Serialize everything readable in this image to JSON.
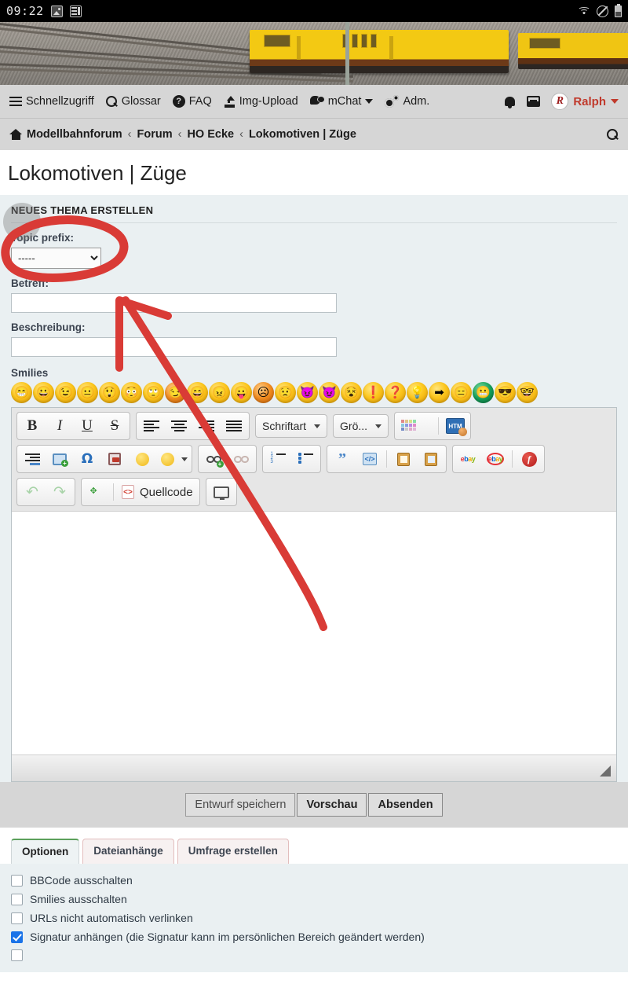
{
  "statusbar": {
    "time": "09:22",
    "left_icons": [
      "photo-icon",
      "news-icon"
    ],
    "right_icons": [
      "wifi-icon",
      "do-not-disturb-icon",
      "battery-icon"
    ]
  },
  "nav": {
    "items": [
      {
        "label": "Schnellzugriff",
        "icon": "hamburger-icon"
      },
      {
        "label": "Glossar",
        "icon": "search-icon"
      },
      {
        "label": "FAQ",
        "icon": "question-circle-icon"
      },
      {
        "label": "Img-Upload",
        "icon": "upload-icon"
      },
      {
        "label": "mChat",
        "icon": "chat-icon",
        "caret": true
      },
      {
        "label": "Adm.",
        "icon": "gears-icon"
      }
    ],
    "notifications_icon": "bell-icon",
    "messages_icon": "inbox-icon",
    "user": {
      "name": "Ralph",
      "avatar_initials": "R",
      "caret": true
    },
    "user_color": "#c0392b"
  },
  "breadcrumb": {
    "home_icon": "home-icon",
    "items": [
      "Modellbahnforum",
      "Forum",
      "HO Ecke",
      "Lokomotiven | Züge"
    ],
    "separator": "‹",
    "search_icon": "search-icon"
  },
  "page": {
    "title": "Lokomotiven | Züge",
    "panel_heading": "NEUES THEMA ERSTELLEN"
  },
  "form": {
    "topic_prefix_label": "Topic prefix:",
    "topic_prefix_value": "-----",
    "topic_prefix_options": [
      "-----"
    ],
    "subject_label": "Betreff:",
    "subject_value": "",
    "subject_placeholder": "",
    "description_label": "Beschreibung:",
    "description_value": "",
    "description_placeholder": "",
    "smilies_label": "Smilies",
    "message_value": ""
  },
  "smilies": [
    {
      "name": "smiley-grin",
      "glyph": "😁",
      "color": "yellow"
    },
    {
      "name": "smiley-smile",
      "glyph": "😀",
      "color": "yellow"
    },
    {
      "name": "smiley-wink",
      "glyph": "😉",
      "color": "yellow"
    },
    {
      "name": "smiley-neutral",
      "glyph": "😐",
      "color": "yellow"
    },
    {
      "name": "smiley-shocked",
      "glyph": "😲",
      "color": "yellow"
    },
    {
      "name": "smiley-eek",
      "glyph": "😳",
      "color": "yellow"
    },
    {
      "name": "smiley-rolleyes",
      "glyph": "🙄",
      "color": "yellow"
    },
    {
      "name": "smiley-cool-wink",
      "glyph": "😏",
      "color": "orange"
    },
    {
      "name": "smiley-laugh",
      "glyph": "😄",
      "color": "yellow"
    },
    {
      "name": "smiley-angry",
      "glyph": "😠",
      "color": "yellow"
    },
    {
      "name": "smiley-tongue",
      "glyph": "😛",
      "color": "yellow"
    },
    {
      "name": "smiley-sad",
      "glyph": "☹",
      "color": "orange"
    },
    {
      "name": "smiley-worried",
      "glyph": "😟",
      "color": "yellow"
    },
    {
      "name": "smiley-devil",
      "glyph": "😈",
      "color": "yellow"
    },
    {
      "name": "smiley-evil-grin",
      "glyph": "😈",
      "color": "yellow"
    },
    {
      "name": "smiley-roll",
      "glyph": "😵",
      "color": "yellow"
    },
    {
      "name": "smiley-exclamation",
      "glyph": "❗",
      "color": "yellow"
    },
    {
      "name": "smiley-question",
      "glyph": "❓",
      "color": "yellow"
    },
    {
      "name": "smiley-idea",
      "glyph": "💡",
      "color": "yellow"
    },
    {
      "name": "smiley-arrow",
      "glyph": "➡",
      "color": "yellow"
    },
    {
      "name": "smiley-indifferent",
      "glyph": "😑",
      "color": "yellow"
    },
    {
      "name": "smiley-green-grin",
      "glyph": "😬",
      "color": "green"
    },
    {
      "name": "smiley-glasses",
      "glyph": "😎",
      "color": "yellow"
    },
    {
      "name": "smiley-nerd",
      "glyph": "🤓",
      "color": "yellow"
    }
  ],
  "toolbar": {
    "row1": {
      "format": [
        {
          "name": "bold-button",
          "label": "B"
        },
        {
          "name": "italic-button",
          "label": "I"
        },
        {
          "name": "underline-button",
          "label": "U"
        },
        {
          "name": "strikethrough-button",
          "label": "S"
        }
      ],
      "align": [
        "align-left-button",
        "align-center-button",
        "align-right-button",
        "align-justify-button"
      ],
      "font_label": "Schriftart",
      "size_label": "Grö...",
      "color_name": "color-palette-button",
      "html_name": "html-insert-button"
    },
    "row2": {
      "group1": [
        "indent-button",
        "insert-image-button",
        "special-char-button",
        "flash-insert-button",
        "emoticon-button",
        "emoticon-more-button"
      ],
      "group2": [
        "insert-link-button",
        "unlink-button"
      ],
      "group3": [
        "ordered-list-button",
        "unordered-list-button"
      ],
      "group4": [
        "quote-button",
        "code-button",
        "edit-note-button",
        "book-button"
      ],
      "group5": [
        "ebay-button",
        "ebay-circle-button",
        "flash-button"
      ]
    },
    "row3": {
      "undo_name": "undo-button",
      "redo_name": "redo-button",
      "expand_name": "fullscreen-button",
      "source_label": "Quellcode",
      "preview_name": "preview-screen-button"
    }
  },
  "actions": {
    "draft_label": "Entwurf speichern",
    "preview_label": "Vorschau",
    "submit_label": "Absenden"
  },
  "tabs": [
    {
      "label": "Optionen",
      "active": true
    },
    {
      "label": "Dateianhänge",
      "active": false
    },
    {
      "label": "Umfrage erstellen",
      "active": false
    }
  ],
  "options": [
    {
      "label": "BBCode ausschalten",
      "checked": false,
      "name": "option-disable-bbcode"
    },
    {
      "label": "Smilies ausschalten",
      "checked": false,
      "name": "option-disable-smilies"
    },
    {
      "label": "URLs nicht automatisch verlinken",
      "checked": false,
      "name": "option-no-autolink"
    },
    {
      "label": "Signatur anhängen (die Signatur kann im persönlichen Bereich geändert werden)",
      "checked": true,
      "name": "option-attach-signature"
    },
    {
      "label": "",
      "checked": false,
      "name": "option-partial"
    }
  ],
  "annotations": {
    "ellipse_color": "#d93b36",
    "arrow_color": "#d93b36",
    "tap_indicator": "gray-circle"
  }
}
